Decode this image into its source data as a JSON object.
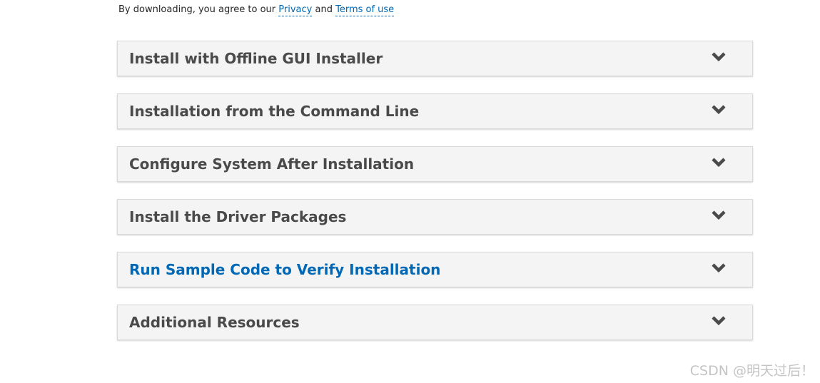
{
  "agreement": {
    "prefix": "By downloading, you agree to our",
    "privacy_link": "Privacy",
    "and": "and",
    "terms_link": "Terms of use"
  },
  "accordion": {
    "panels": [
      {
        "title": "Install with Offline GUI Installer",
        "active": false
      },
      {
        "title": "Installation from the Command Line",
        "active": false
      },
      {
        "title": "Configure System After Installation",
        "active": false
      },
      {
        "title": "Install the Driver Packages",
        "active": false
      },
      {
        "title": "Run Sample Code to Verify Installation",
        "active": true
      },
      {
        "title": "Additional Resources",
        "active": false
      }
    ],
    "expand_icon": "chevron-down-icon"
  },
  "colors": {
    "link": "#0068b5",
    "panel_bg": "#f4f4f4",
    "title_text": "#4a4a4a",
    "active_title_text": "#0068b5",
    "chevron": "#4a4a4a"
  },
  "watermark": {
    "text": "CSDN @明天过后！"
  }
}
